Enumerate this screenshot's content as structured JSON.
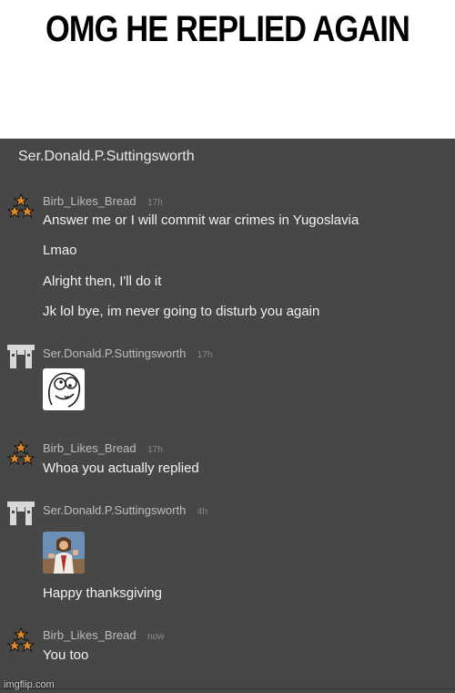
{
  "meme": {
    "caption": "OMG HE REPLIED AGAIN",
    "watermark": "imgflip.com"
  },
  "chat": {
    "header_title": "Ser.Donald.P.Suttingsworth",
    "groups": [
      {
        "author": "Birb_Likes_Bread",
        "time": "17h",
        "avatar_icon": "three-stars-icon",
        "messages": [
          "Answer me or I will commit war crimes in Yugoslavia",
          "Lmao",
          "Alright then, I'll do it",
          "Jk lol bye, im never going to disturb you again"
        ]
      },
      {
        "author": "Ser.Donald.P.Suttingsworth",
        "time": "17h",
        "avatar_icon": "pixel-pillars-icon",
        "attachment": "derp-rage-face-image"
      },
      {
        "author": "Birb_Likes_Bread",
        "time": "17h",
        "avatar_icon": "three-stars-icon",
        "messages": [
          "Whoa you actually replied"
        ]
      },
      {
        "author": "Ser.Donald.P.Suttingsworth",
        "time": "4h",
        "avatar_icon": "pixel-pillars-icon",
        "attachment": "buddy-christ-image",
        "messages": [
          "Happy thanksgiving"
        ]
      },
      {
        "author": "Birb_Likes_Bread",
        "time": "now",
        "avatar_icon": "three-stars-icon",
        "messages": [
          "You too"
        ]
      }
    ]
  },
  "colors": {
    "chat_background": "#474747",
    "message_text": "#f2f2f2",
    "author_text": "#bdbdbd",
    "star_fill": "#e08a2a"
  }
}
